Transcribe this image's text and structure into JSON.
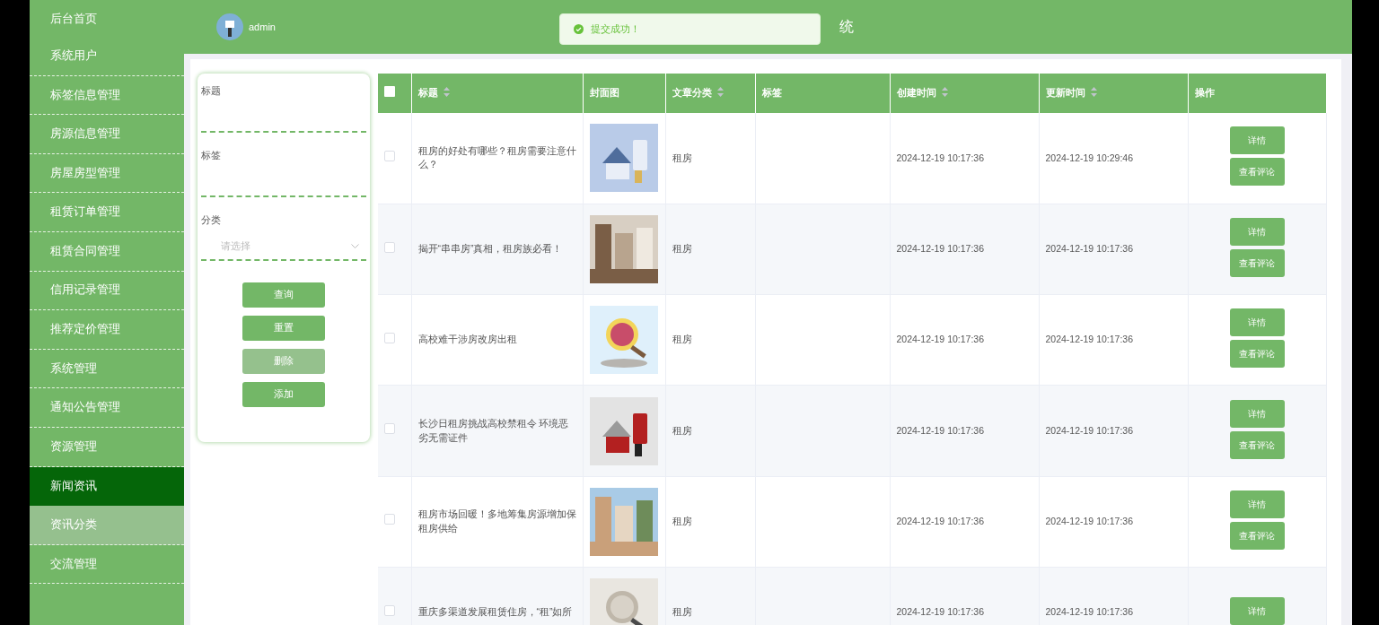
{
  "sidebar": {
    "items": [
      {
        "label": "后台首页",
        "selected": false,
        "hovered": false
      },
      {
        "label": "系统用户",
        "selected": false,
        "hovered": false
      },
      {
        "label": "标签信息管理",
        "selected": false,
        "hovered": false
      },
      {
        "label": "房源信息管理",
        "selected": false,
        "hovered": false
      },
      {
        "label": "房屋房型管理",
        "selected": false,
        "hovered": false
      },
      {
        "label": "租赁订单管理",
        "selected": false,
        "hovered": false
      },
      {
        "label": "租赁合同管理",
        "selected": false,
        "hovered": false
      },
      {
        "label": "信用记录管理",
        "selected": false,
        "hovered": false
      },
      {
        "label": "推荐定价管理",
        "selected": false,
        "hovered": false
      },
      {
        "label": "系统管理",
        "selected": false,
        "hovered": false
      },
      {
        "label": "通知公告管理",
        "selected": false,
        "hovered": false
      },
      {
        "label": "资源管理",
        "selected": false,
        "hovered": false
      },
      {
        "label": "新闻资讯",
        "selected": true,
        "hovered": false
      },
      {
        "label": "资讯分类",
        "selected": false,
        "hovered": true
      },
      {
        "label": "交流管理",
        "selected": false,
        "hovered": false
      }
    ]
  },
  "header": {
    "user": "admin",
    "title": "统"
  },
  "toast": {
    "kind": "success",
    "message": "提交成功！"
  },
  "search": {
    "fields": [
      {
        "kind": "text",
        "label": "标题"
      },
      {
        "kind": "text",
        "label": "标签"
      },
      {
        "kind": "select",
        "label": "分类",
        "placeholder": "请选择"
      }
    ],
    "buttons": [
      {
        "label": "查询",
        "disabled": false
      },
      {
        "label": "重置",
        "disabled": false
      },
      {
        "label": "删除",
        "disabled": true
      },
      {
        "label": "添加",
        "disabled": false
      }
    ]
  },
  "table": {
    "select_all": {
      "checked": false
    },
    "columns": [
      {
        "label": "标题",
        "sortable": true
      },
      {
        "label": "封面图",
        "sortable": false
      },
      {
        "label": "文章分类",
        "sortable": true
      },
      {
        "label": "标签",
        "sortable": false
      },
      {
        "label": "创建时间",
        "sortable": true
      },
      {
        "label": "更新时间",
        "sortable": true
      },
      {
        "label": "操作",
        "sortable": false
      }
    ],
    "rows": [
      {
        "checked": false,
        "title": "租房的好处有哪些？租房需要注意什么？",
        "cover": {
          "kind": "picture"
        },
        "category": "租房",
        "created": "2024-12-19 10:17:36",
        "updated": "2024-12-19 10:29:46",
        "actions": [
          "详情",
          "查看评论"
        ]
      },
      {
        "checked": false,
        "title": "揭开“串串房”真相，租房族必看！",
        "cover": {
          "kind": "picture"
        },
        "category": "租房",
        "created": "2024-12-19 10:17:36",
        "updated": "2024-12-19 10:17:36",
        "actions": [
          "详情",
          "查看评论"
        ]
      },
      {
        "checked": false,
        "title": "高校难干涉房改房出租",
        "cover": {
          "kind": "picture"
        },
        "category": "租房",
        "created": "2024-12-19 10:17:36",
        "updated": "2024-12-19 10:17:36",
        "actions": [
          "详情",
          "查看评论"
        ]
      },
      {
        "checked": false,
        "title": "长沙日租房挑战高校禁租令 环境恶劣无需证件",
        "cover": {
          "kind": "picture"
        },
        "category": "租房",
        "created": "2024-12-19 10:17:36",
        "updated": "2024-12-19 10:17:36",
        "actions": [
          "详情",
          "查看评论"
        ]
      },
      {
        "checked": false,
        "title": "租房市场回暖！多地筹集房源增加保租房供给",
        "cover": {
          "kind": "picture"
        },
        "category": "租房",
        "created": "2024-12-19 10:17:36",
        "updated": "2024-12-19 10:17:36",
        "actions": [
          "详情",
          "查看评论"
        ]
      },
      {
        "checked": false,
        "title": "重庆多渠道发展租赁住房，“租”如所",
        "cover": {
          "kind": "picture"
        },
        "category": "租房",
        "created": "2024-12-19 10:17:36",
        "updated": "2024-12-19 10:17:36",
        "actions": [
          "详情"
        ]
      }
    ]
  }
}
